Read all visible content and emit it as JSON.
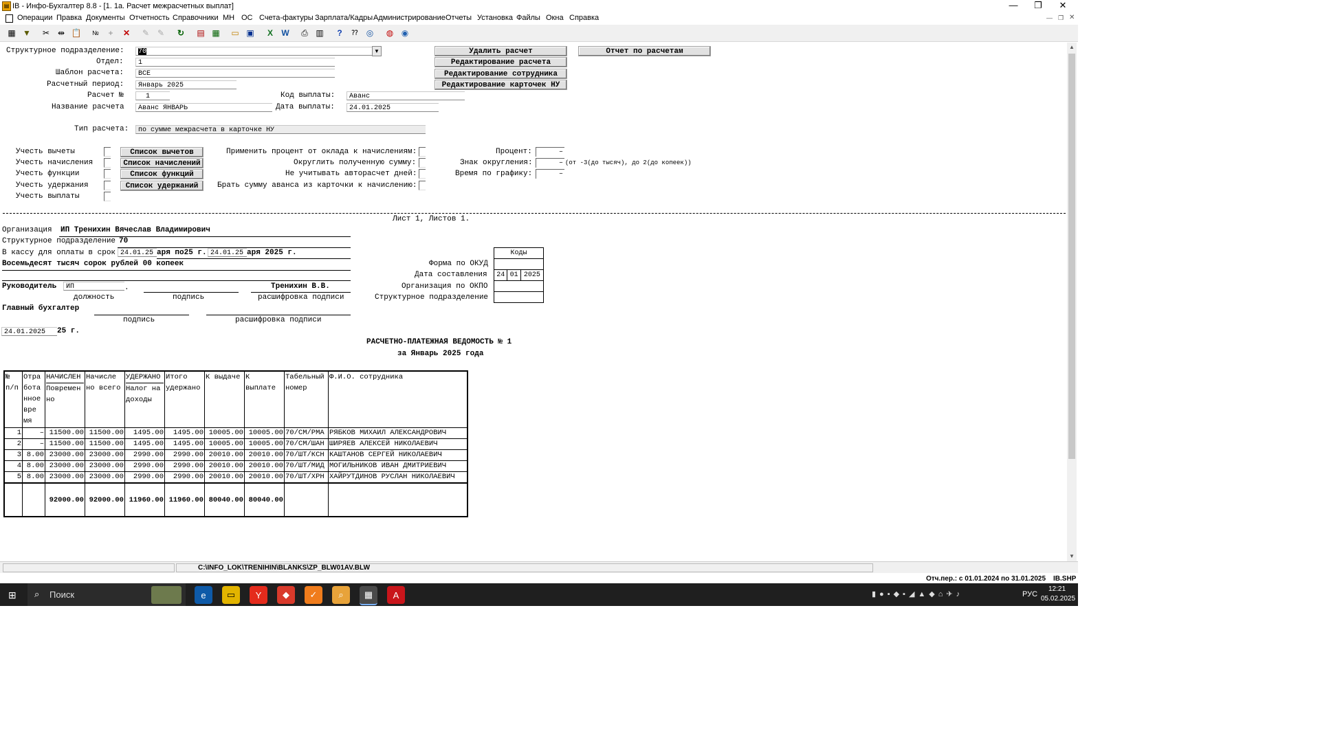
{
  "window": {
    "title": "IB - Инфо-Бухгалтер 8.8 - [1. 1а. Расчет межрасчетных выплат]",
    "controls": {
      "minimize": "—",
      "restore": "❐",
      "close": "✕"
    }
  },
  "menu": [
    "Операции",
    "Правка",
    "Документы",
    "Отчетность",
    "Справочники",
    "МН",
    "ОС",
    "Счета-фактуры",
    "Зарплата/Кадры",
    "Администрирование",
    "Отчеты",
    "Установка",
    "Файлы",
    "Окна",
    "Справка"
  ],
  "form": {
    "struct_label": "Структурное подразделение:",
    "struct_value": "70",
    "dept_label": "Отдел:",
    "dept_value": "1",
    "template_label": "Шаблон расчета:",
    "template_value": "ВСЕ",
    "period_label": "Расчетный период:",
    "period_value": "Январь 2025",
    "calc_no_label": "Расчет №",
    "calc_no_value": "1",
    "payment_code_label": "Код выплаты:",
    "payment_code_value": "Аванс",
    "calc_name_label": "Название расчета",
    "calc_name_value": "Аванс ЯНВАРЬ",
    "pay_date_label": "Дата выплаты:",
    "pay_date_value": "24.01.2025",
    "calc_type_label": "Тип расчета:",
    "calc_type_value": "по сумме межрасчета в карточке НУ",
    "btn_delete": "Удалить расчет",
    "btn_edit_calc": "Редактирование расчета",
    "btn_edit_emp": "Редактирование сотрудника",
    "btn_edit_cards": "Редактирование карточек НУ",
    "btn_report": "Отчет по расчетам",
    "opt_deductions": "Учесть вычеты",
    "opt_accruals": "Учесть начисления",
    "opt_functions": "Учесть функции",
    "opt_withholdings": "Учесть удержания",
    "opt_payments": "Учесть выплаты",
    "btn_list_deductions": "Список вычетов",
    "btn_list_accruals": "Список начислений",
    "btn_list_functions": "Список функций",
    "btn_list_withholdings": "Список удержаний",
    "apply_percent_label": "Применить процент от оклада к начислениям:",
    "round_label": "Округлить полученную сумму:",
    "no_auto_days_label": "Не учитывать авторасчет дней:",
    "take_advance_label": "Брать сумму аванса из карточки к начислению:",
    "percent_label": "Процент:",
    "percent_value": "–",
    "round_sign_label": "Знак округления:",
    "round_sign_value": "–",
    "round_hint": "(от -3(до тысяч), до 2(до копеек))",
    "schedule_label": "Время по графику:",
    "schedule_value": "–"
  },
  "doc": {
    "sheet": "Лист 1, Листов 1.",
    "org_label": "Организация",
    "org_value": "ИП Тренихин Вячеслав Владимирович",
    "struct_label": "Структурное подразделение",
    "struct_value": "70",
    "kassa_prefix": "В кассу для оплаты в срок",
    "kassa_from": "24.01.25",
    "kassa_mid": "аря по25 г.",
    "kassa_to": "24.01.25",
    "kassa_suffix": "аря 2025 г.",
    "amount_words": "Восемьдесят тысяч сорок рублей 00 копеек",
    "head_label": "Руководитель",
    "head_position": "ИП",
    "head_name": "Тренихин В.В.",
    "cap_position": "должность",
    "cap_signature": "подпись",
    "cap_decode": "расшифровка подписи",
    "chief_acc_label": "Главный бухгалтер",
    "cap_signature2": "подпись",
    "cap_decode2": "расшифровка подписи",
    "date_value": "24.01.2025",
    "date_suffix": "25 г.",
    "codes_header": "Коды",
    "okud_label": "Форма по ОКУД",
    "compose_date_label": "Дата составления",
    "compose_day": "24",
    "compose_month": "01",
    "compose_year": "2025",
    "okpo_label": "Организация по ОКПО",
    "struct2_label": "Структурное подразделение",
    "title": "РАСЧЕТНО-ПЛАТЕЖНАЯ ВЕДОМОСТЬ № 1",
    "subtitle": "за Январь 2025 года"
  },
  "table": {
    "headers": {
      "no": [
        "№",
        "п/п"
      ],
      "worked": [
        "Отра",
        "бота",
        "нное",
        "вре",
        "мя"
      ],
      "accr_top": "НАЧИСЛЕН",
      "accr_sub": [
        "Повремен",
        "но"
      ],
      "accr_total": [
        "Начисле",
        "но всего"
      ],
      "withh_top": "УДЕРЖАНО",
      "withh_sub": [
        "Налог на",
        "доходы"
      ],
      "withh_total": [
        "Итого",
        "удержано"
      ],
      "to_issue": "К выдаче",
      "to_pay": [
        "К",
        "выплате"
      ],
      "tab_no": [
        "Табельный",
        "номер"
      ],
      "fio": "Ф.И.О. сотрудника"
    },
    "rows": [
      [
        "1",
        "–",
        "11500.00",
        "11500.00",
        "1495.00",
        "1495.00",
        "10005.00",
        "10005.00",
        "70/СМ/РМА",
        "РЯБКОВ МИХАИЛ АЛЕКСАНДРОВИЧ"
      ],
      [
        "2",
        "–",
        "11500.00",
        "11500.00",
        "1495.00",
        "1495.00",
        "10005.00",
        "10005.00",
        "70/СМ/ШАН",
        "ШИРЯЕВ АЛЕКСЕЙ НИКОЛАЕВИЧ"
      ],
      [
        "3",
        "8.00",
        "23000.00",
        "23000.00",
        "2990.00",
        "2990.00",
        "20010.00",
        "20010.00",
        "70/ШТ/КСН",
        "КАШТАНОВ СЕРГЕЙ НИКОЛАЕВИЧ"
      ],
      [
        "4",
        "8.00",
        "23000.00",
        "23000.00",
        "2990.00",
        "2990.00",
        "20010.00",
        "20010.00",
        "70/ШТ/МИД",
        "МОГИЛЬНИКОВ ИВАН ДМИТРИЕВИЧ"
      ],
      [
        "5",
        "8.00",
        "23000.00",
        "23000.00",
        "2990.00",
        "2990.00",
        "20010.00",
        "20010.00",
        "70/ШТ/ХРН",
        "ХАЙРУТДИНОВ РУСЛАН НИКОЛАЕВИЧ"
      ]
    ],
    "totals": [
      "",
      "",
      "92000.00",
      "92000.00",
      "11960.00",
      "11960.00",
      "80040.00",
      "80040.00",
      "",
      ""
    ]
  },
  "status": {
    "path": "C:\\INFO_LOK\\TRENIHIN\\BLANKS\\ZP_BLW01AV.BLW",
    "period": "Отч.пер.: с 01.01.2024 по 31.01.2025",
    "db": "IB.SHP"
  },
  "taskbar": {
    "search": "Поиск",
    "lang": "РУС",
    "time": "12:21",
    "date": "05.02.2025"
  }
}
